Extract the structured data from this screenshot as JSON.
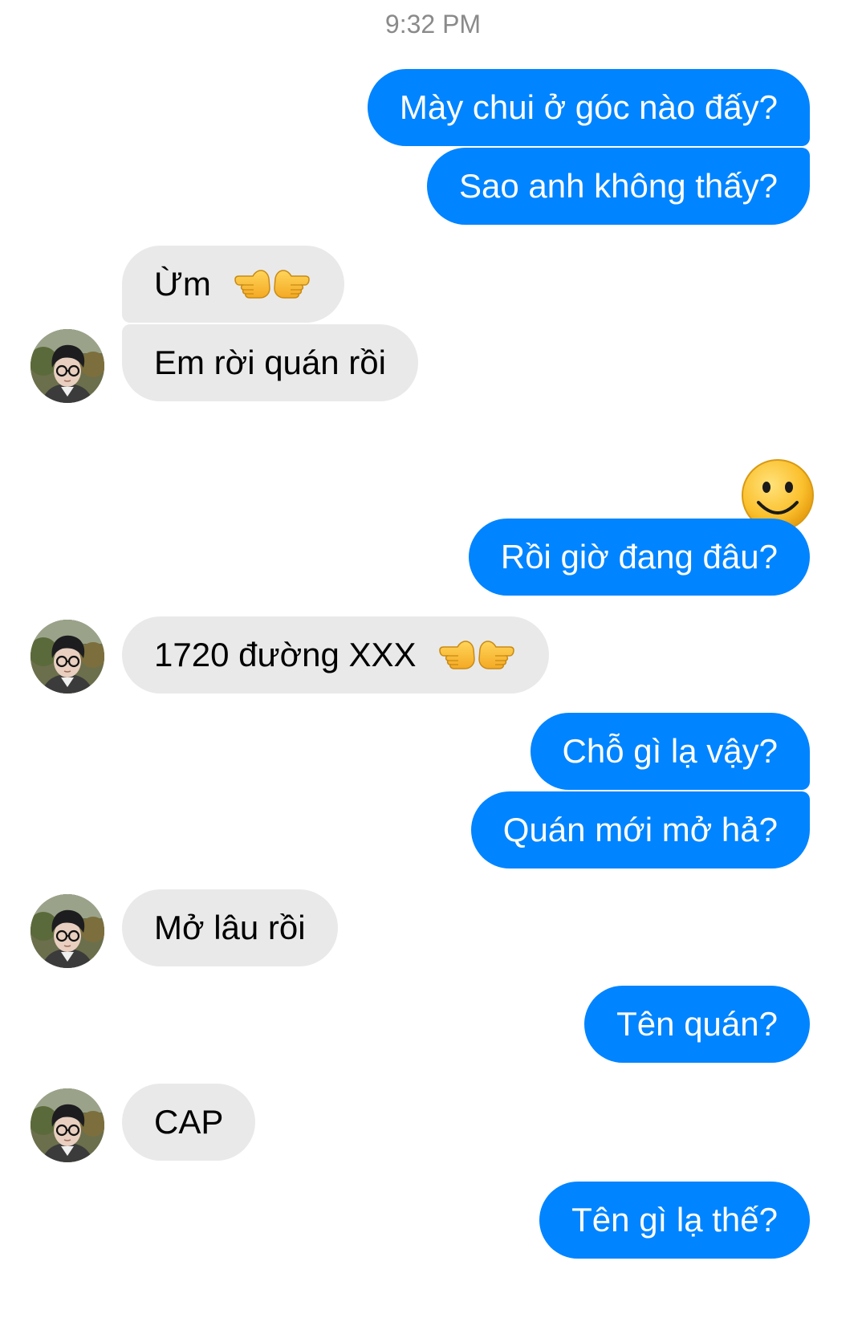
{
  "timestamp": "9:32 PM",
  "messages": [
    {
      "id": "m1",
      "sender": "me",
      "text": "Mày chui ở góc nào đấy?"
    },
    {
      "id": "m2",
      "sender": "me",
      "text": "Sao anh không thấy?"
    },
    {
      "id": "m3",
      "sender": "friend",
      "text": "Ừm",
      "emoji": "pointing-hands"
    },
    {
      "id": "m4",
      "sender": "friend",
      "text": "Em rời quán rồi"
    },
    {
      "id": "m5",
      "sender": "me",
      "emoji": "slightly-smiling-face"
    },
    {
      "id": "m6",
      "sender": "me",
      "text": "Rồi giờ đang đâu?"
    },
    {
      "id": "m7",
      "sender": "friend",
      "text": "1720 đường XXX",
      "emoji": "pointing-hands"
    },
    {
      "id": "m8",
      "sender": "me",
      "text": "Chỗ gì lạ vậy?"
    },
    {
      "id": "m9",
      "sender": "me",
      "text": "Quán mới mở hả?"
    },
    {
      "id": "m10",
      "sender": "friend",
      "text": "Mở lâu rồi"
    },
    {
      "id": "m11",
      "sender": "me",
      "text": "Tên quán?"
    },
    {
      "id": "m12",
      "sender": "friend",
      "text": "CAP"
    },
    {
      "id": "m13",
      "sender": "me",
      "text": "Tên gì lạ thế?"
    }
  ],
  "colors": {
    "outgoing_bubble": "#0084ff",
    "incoming_bubble": "#e9e9e9",
    "timestamp_text": "#8a8a8a"
  }
}
